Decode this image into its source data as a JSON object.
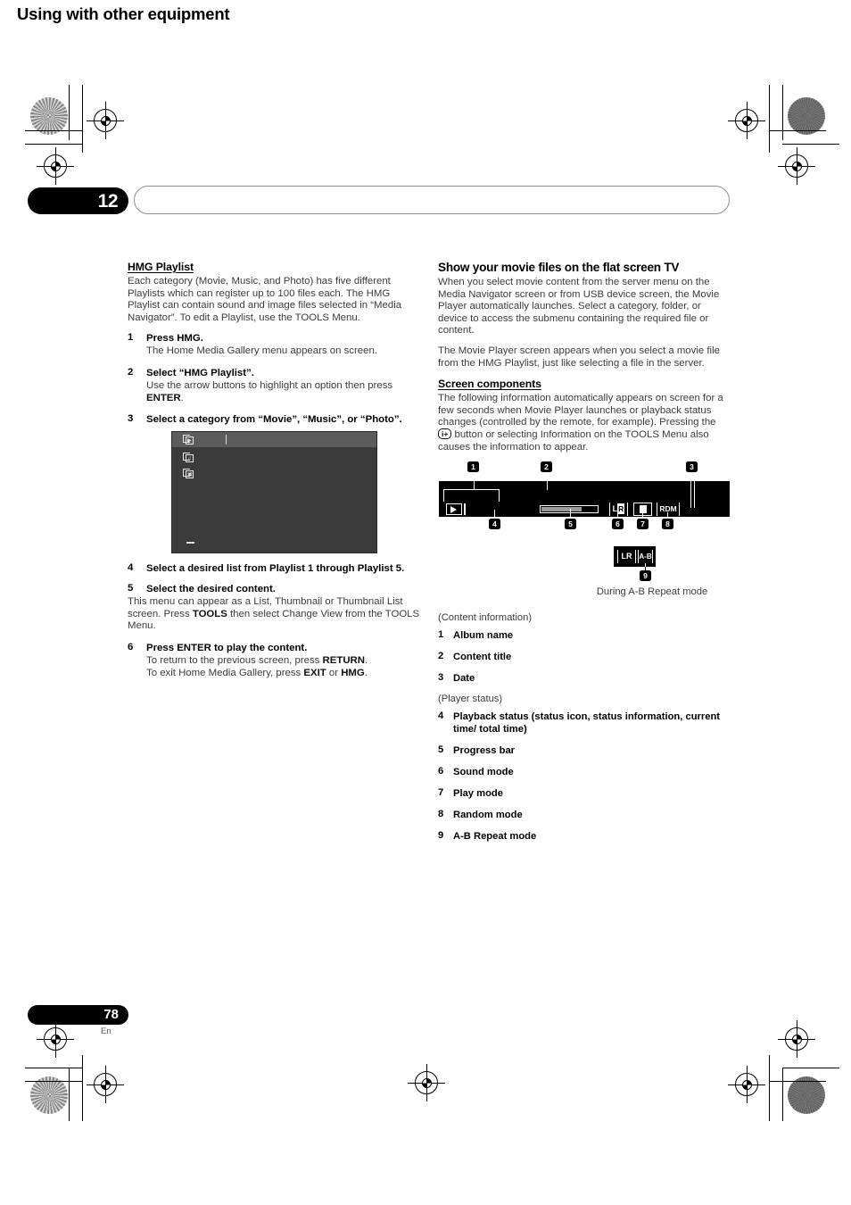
{
  "header": {
    "chapter_number": "12",
    "chapter_title": "Using with other equipment"
  },
  "footer": {
    "page_number": "78",
    "language": "En"
  },
  "left_column": {
    "section_title": "HMG Playlist",
    "intro": "Each category (Movie, Music, and Photo) has five different Playlists which can register up to 100 files each. The HMG Playlist can contain sound and image files selected in “Media Navigator”. To edit a Playlist, use the TOOLS Menu.",
    "steps": [
      {
        "num": "1",
        "title": "Press HMG.",
        "body": "The Home Media Gallery menu appears on screen."
      },
      {
        "num": "2",
        "title": "Select “HMG Playlist”.",
        "body_pre": "Use the arrow buttons to highlight an option then press ",
        "body_bold": "ENTER",
        "body_post": "."
      },
      {
        "num": "3",
        "title": "Select a category from “Movie”, “Music”, or “Photo”."
      },
      {
        "num": "4",
        "title": "Select a desired list from Playlist 1 through Playlist 5."
      },
      {
        "num": "5",
        "title": "Select the desired content.",
        "body_pre": "This menu can appear as a List, Thumbnail or Thumbnail List screen. Press ",
        "body_bold": "TOOLS",
        "body_post": " then select Change View from the TOOLS Menu."
      },
      {
        "num": "6",
        "title": "Press ENTER to play the content.",
        "line1_pre": "To return to the previous screen, press ",
        "line1_bold": "RETURN",
        "line1_post": ".",
        "line2_pre": "To exit Home Media Gallery, press ",
        "line2_bold1": "EXIT",
        "line2_mid": " or ",
        "line2_bold2": "HMG",
        "line2_post": "."
      }
    ],
    "menu_screenshot": {
      "icons": [
        {
          "name": "movie-category-icon",
          "glyph": "▶"
        },
        {
          "name": "music-category-icon",
          "glyph": "♫"
        },
        {
          "name": "photo-category-icon",
          "glyph": "▣"
        }
      ]
    }
  },
  "right_column": {
    "section_title": "Show your movie files on the flat screen TV",
    "paragraph_1": "When you select movie content from the server menu on the Media Navigator screen or from USB device screen, the Movie Player automatically launches. Select a category, folder, or device to access the submenu containing the required file or content.",
    "paragraph_2": "The Movie Player screen appears when you select a movie file from the HMG Playlist, just like selecting a file in the server.",
    "screen_components": {
      "heading": "Screen components",
      "text_pre": "The following information automatically appears on screen for a few seconds when Movie Player launches or playback status changes (controlled by the remote, for example). Pressing the ",
      "button_glyph": "i+",
      "text_post": " button or selecting Information on the TOOLS Menu also causes the information to appear."
    },
    "diagram": {
      "callouts": [
        "1",
        "2",
        "3",
        "4",
        "5",
        "6",
        "7",
        "8",
        "9"
      ],
      "player_bar": {
        "status_icon": "play-icon",
        "sound_mode_left": "L",
        "sound_mode_right": "R",
        "random_mode": "RDM"
      },
      "ab_box": {
        "sound_mode_left": "L",
        "sound_mode_right": "R",
        "ab_label": "A-B"
      },
      "caption": "During A-B Repeat mode"
    },
    "legend": {
      "content_information_head": "(Content information)",
      "content_items": [
        {
          "num": "1",
          "label": "Album name"
        },
        {
          "num": "2",
          "label": "Content title"
        },
        {
          "num": "3",
          "label": "Date"
        }
      ],
      "player_status_head": "(Player status)",
      "player_items": [
        {
          "num": "4",
          "label": "Playback status (status icon, status information, current time/ total time)"
        },
        {
          "num": "5",
          "label": "Progress bar"
        },
        {
          "num": "6",
          "label": "Sound mode"
        },
        {
          "num": "7",
          "label": "Play mode"
        },
        {
          "num": "8",
          "label": "Random mode"
        },
        {
          "num": "9",
          "label": "A-B Repeat mode"
        }
      ]
    }
  }
}
